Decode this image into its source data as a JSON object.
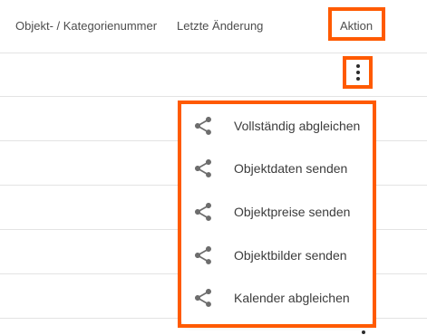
{
  "table": {
    "columns": {
      "object_category_number": "Objekt- / Kategorienummer",
      "last_change": "Letzte Änderung",
      "action": "Aktion"
    }
  },
  "row_actions": {
    "kebab_icon": "more-vert-icon",
    "menu": {
      "items": [
        {
          "label": "Vollständig abgleichen",
          "icon": "share-icon"
        },
        {
          "label": "Objektdaten senden",
          "icon": "share-icon"
        },
        {
          "label": "Objektpreise senden",
          "icon": "share-icon"
        },
        {
          "label": "Objektbilder senden",
          "icon": "share-icon"
        },
        {
          "label": "Kalender abgleichen",
          "icon": "share-icon"
        }
      ]
    }
  },
  "colors": {
    "highlight": "#ff5a00",
    "icon": "#6d6d6d",
    "text": "#3c3c3c",
    "divider": "#e3e3e3"
  }
}
